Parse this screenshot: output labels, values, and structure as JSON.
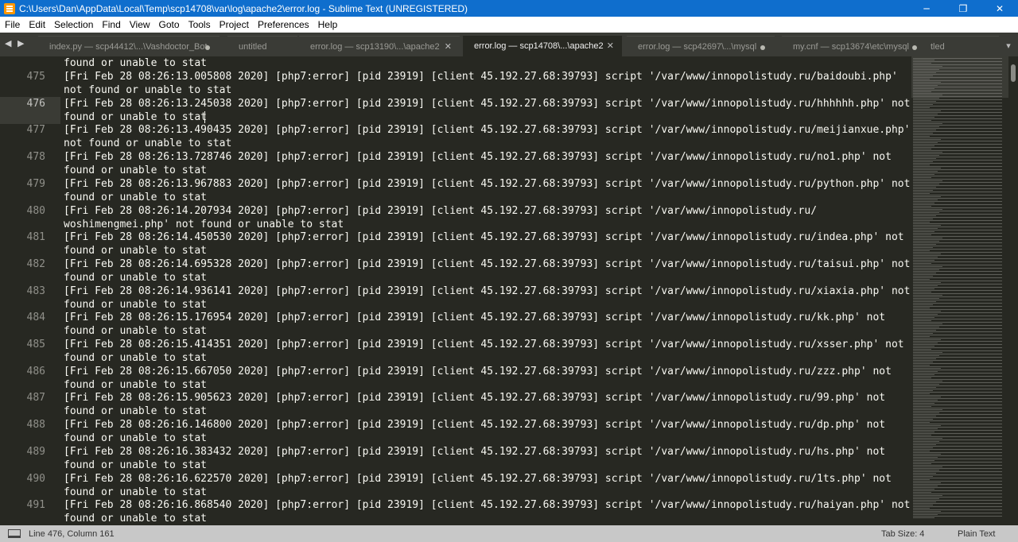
{
  "window": {
    "title": "C:\\Users\\Dan\\AppData\\Local\\Temp\\scp14708\\var\\log\\apache2\\error.log - Sublime Text (UNREGISTERED)",
    "minimize": "─",
    "maximize": "❐",
    "close": "✕"
  },
  "menu": [
    "File",
    "Edit",
    "Selection",
    "Find",
    "View",
    "Goto",
    "Tools",
    "Project",
    "Preferences",
    "Help"
  ],
  "tabs": {
    "nav": "◀ ▶",
    "items": [
      {
        "label": "index.py — scp44412\\...\\Vashdoctor_Bot"
      },
      {
        "label": "untitled"
      },
      {
        "label": "error.log — scp13190\\...\\apache2",
        "close": "✕"
      },
      {
        "label": "error.log — scp14708\\...\\apache2",
        "close": "✕"
      },
      {
        "label": "error.log — scp42697\\...\\mysql"
      },
      {
        "label": "my.cnf — scp13674\\etc\\mysql"
      },
      {
        "label": "tled"
      }
    ],
    "overflow": "▾"
  },
  "editor": {
    "top_fragment": "found or unable to stat",
    "lines": [
      {
        "num": "475",
        "text": "[Fri Feb 28 08:26:13.005808 2020] [php7:error] [pid 23919] [client 45.192.27.68:39793] script '/var/www/innopolistudy.ru/baidoubi.php'\nnot found or unable to stat"
      },
      {
        "num": "476",
        "text": "[Fri Feb 28 08:26:13.245038 2020] [php7:error] [pid 23919] [client 45.192.27.68:39793] script '/var/www/innopolistudy.ru/hhhhhh.php' not\nfound or unable to stat"
      },
      {
        "num": "477",
        "text": "[Fri Feb 28 08:26:13.490435 2020] [php7:error] [pid 23919] [client 45.192.27.68:39793] script '/var/www/innopolistudy.ru/meijianxue.php'\nnot found or unable to stat"
      },
      {
        "num": "478",
        "text": "[Fri Feb 28 08:26:13.728746 2020] [php7:error] [pid 23919] [client 45.192.27.68:39793] script '/var/www/innopolistudy.ru/no1.php' not\nfound or unable to stat"
      },
      {
        "num": "479",
        "text": "[Fri Feb 28 08:26:13.967883 2020] [php7:error] [pid 23919] [client 45.192.27.68:39793] script '/var/www/innopolistudy.ru/python.php' not\nfound or unable to stat"
      },
      {
        "num": "480",
        "text": "[Fri Feb 28 08:26:14.207934 2020] [php7:error] [pid 23919] [client 45.192.27.68:39793] script '/var/www/innopolistudy.ru/\nwoshimengmei.php' not found or unable to stat"
      },
      {
        "num": "481",
        "text": "[Fri Feb 28 08:26:14.450530 2020] [php7:error] [pid 23919] [client 45.192.27.68:39793] script '/var/www/innopolistudy.ru/indea.php' not\nfound or unable to stat"
      },
      {
        "num": "482",
        "text": "[Fri Feb 28 08:26:14.695328 2020] [php7:error] [pid 23919] [client 45.192.27.68:39793] script '/var/www/innopolistudy.ru/taisui.php' not\nfound or unable to stat"
      },
      {
        "num": "483",
        "text": "[Fri Feb 28 08:26:14.936141 2020] [php7:error] [pid 23919] [client 45.192.27.68:39793] script '/var/www/innopolistudy.ru/xiaxia.php' not\nfound or unable to stat"
      },
      {
        "num": "484",
        "text": "[Fri Feb 28 08:26:15.176954 2020] [php7:error] [pid 23919] [client 45.192.27.68:39793] script '/var/www/innopolistudy.ru/kk.php' not\nfound or unable to stat"
      },
      {
        "num": "485",
        "text": "[Fri Feb 28 08:26:15.414351 2020] [php7:error] [pid 23919] [client 45.192.27.68:39793] script '/var/www/innopolistudy.ru/xsser.php' not\nfound or unable to stat"
      },
      {
        "num": "486",
        "text": "[Fri Feb 28 08:26:15.667050 2020] [php7:error] [pid 23919] [client 45.192.27.68:39793] script '/var/www/innopolistudy.ru/zzz.php' not\nfound or unable to stat"
      },
      {
        "num": "487",
        "text": "[Fri Feb 28 08:26:15.905623 2020] [php7:error] [pid 23919] [client 45.192.27.68:39793] script '/var/www/innopolistudy.ru/99.php' not\nfound or unable to stat"
      },
      {
        "num": "488",
        "text": "[Fri Feb 28 08:26:16.146800 2020] [php7:error] [pid 23919] [client 45.192.27.68:39793] script '/var/www/innopolistudy.ru/dp.php' not\nfound or unable to stat"
      },
      {
        "num": "489",
        "text": "[Fri Feb 28 08:26:16.383432 2020] [php7:error] [pid 23919] [client 45.192.27.68:39793] script '/var/www/innopolistudy.ru/hs.php' not\nfound or unable to stat"
      },
      {
        "num": "490",
        "text": "[Fri Feb 28 08:26:16.622570 2020] [php7:error] [pid 23919] [client 45.192.27.68:39793] script '/var/www/innopolistudy.ru/1ts.php' not\nfound or unable to stat"
      },
      {
        "num": "491",
        "text": "[Fri Feb 28 08:26:16.868540 2020] [php7:error] [pid 23919] [client 45.192.27.68:39793] script '/var/www/innopolistudy.ru/haiyan.php' not\nfound or unable to stat"
      }
    ]
  },
  "status": {
    "position": "Line 476, Column 161",
    "tab_size": "Tab Size: 4",
    "syntax": "Plain Text"
  },
  "colors": {
    "titlebar": "#0f6ecd",
    "editor_bg": "#272822",
    "text": "#f8f8f2",
    "status_bg": "#c8c8c8"
  }
}
